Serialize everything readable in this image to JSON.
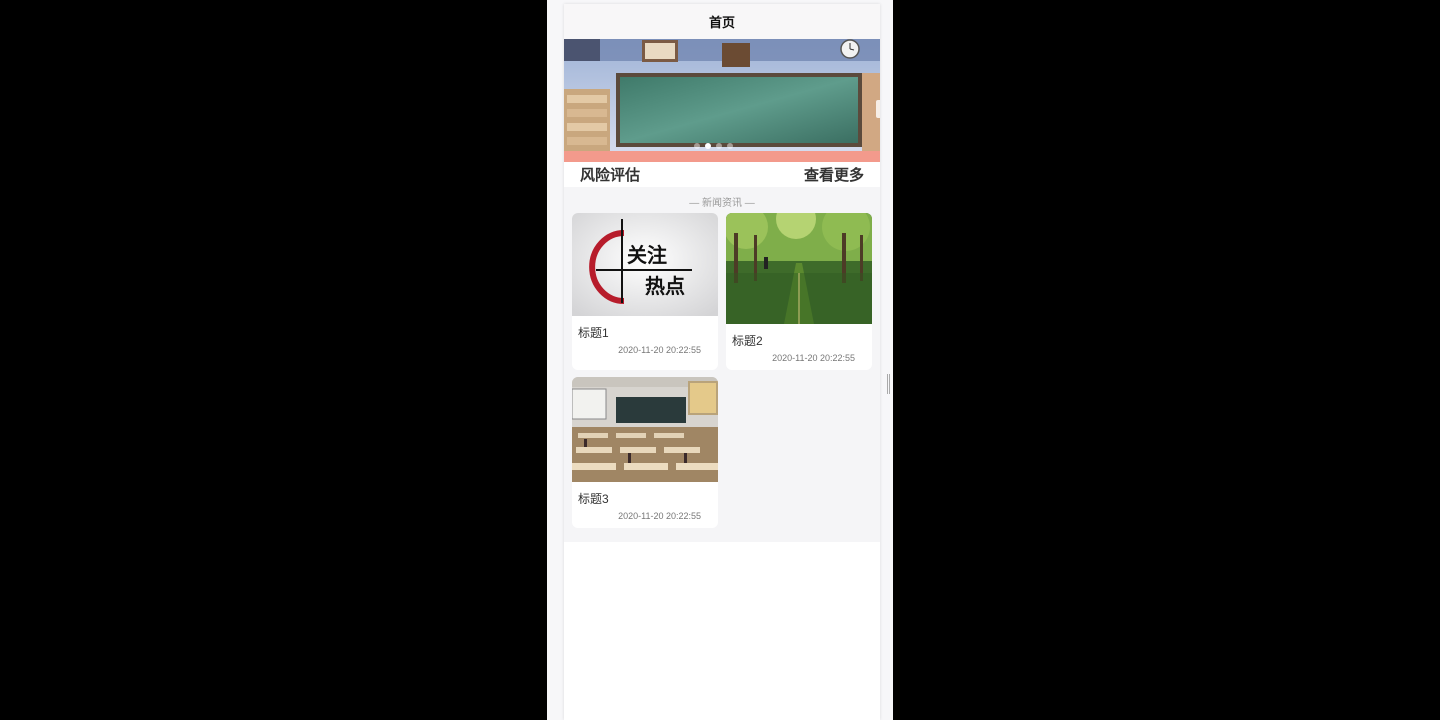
{
  "navbar": {
    "title": "首页"
  },
  "links": {
    "left": "风险评估",
    "right": "查看更多"
  },
  "news": {
    "heading": "— 新闻资讯 —",
    "items": [
      {
        "title": "标题1",
        "time": "2020-11-20 20:22:55",
        "thumb_text_top": "关注",
        "thumb_text_bottom": "热点"
      },
      {
        "title": "标题2",
        "time": "2020-11-20 20:22:55"
      },
      {
        "title": "标题3",
        "time": "2020-11-20 20:22:55"
      }
    ]
  },
  "banner": {
    "slide_count": 4,
    "active_index": 1
  },
  "colors": {
    "accent": "#f39a8c",
    "brand_red": "#b71c2b"
  }
}
